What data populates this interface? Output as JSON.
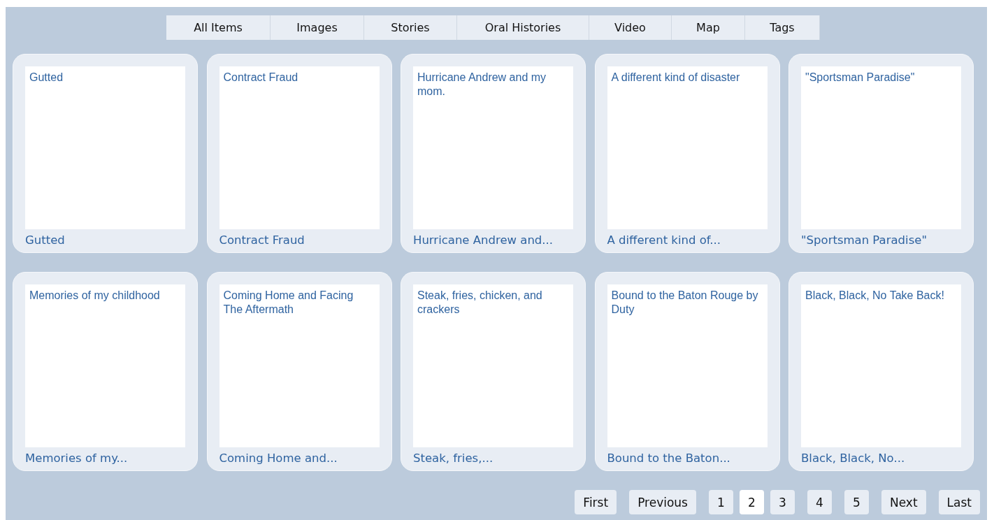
{
  "tabs": [
    {
      "label": "All Items",
      "selected": false
    },
    {
      "label": "Images",
      "selected": false
    },
    {
      "label": "Stories",
      "selected": false
    },
    {
      "label": "Oral Histories",
      "selected": false
    },
    {
      "label": "Video",
      "selected": false
    },
    {
      "label": "Map",
      "selected": false
    },
    {
      "label": "Tags",
      "selected": false
    }
  ],
  "items": [
    {
      "title": "Gutted",
      "caption": "Gutted"
    },
    {
      "title": "Contract Fraud",
      "caption": "Contract Fraud"
    },
    {
      "title": "Hurricane Andrew and my mom.",
      "caption": "Hurricane Andrew and..."
    },
    {
      "title": "A different kind of disaster",
      "caption": "A different kind of..."
    },
    {
      "title": "\"Sportsman Paradise\"",
      "caption": "\"Sportsman Paradise\""
    },
    {
      "title": "Memories of my childhood",
      "caption": "Memories of my..."
    },
    {
      "title": "Coming Home and Facing The Aftermath",
      "caption": "Coming Home and..."
    },
    {
      "title": "Steak, fries, chicken, and crackers",
      "caption": "Steak, fries,..."
    },
    {
      "title": "Bound to the Baton Rouge by Duty",
      "caption": "Bound to the Baton..."
    },
    {
      "title": "Black, Black, No Take Back!",
      "caption": "Black, Black, No..."
    }
  ],
  "pagination": {
    "first": "First",
    "previous": "Previous",
    "pages": [
      {
        "label": "1",
        "selected": false
      },
      {
        "label": "2",
        "selected": true
      },
      {
        "label": "3",
        "selected": false
      },
      {
        "label": "4",
        "selected": false
      },
      {
        "label": "5",
        "selected": false
      }
    ],
    "next": "Next",
    "last": "Last"
  }
}
